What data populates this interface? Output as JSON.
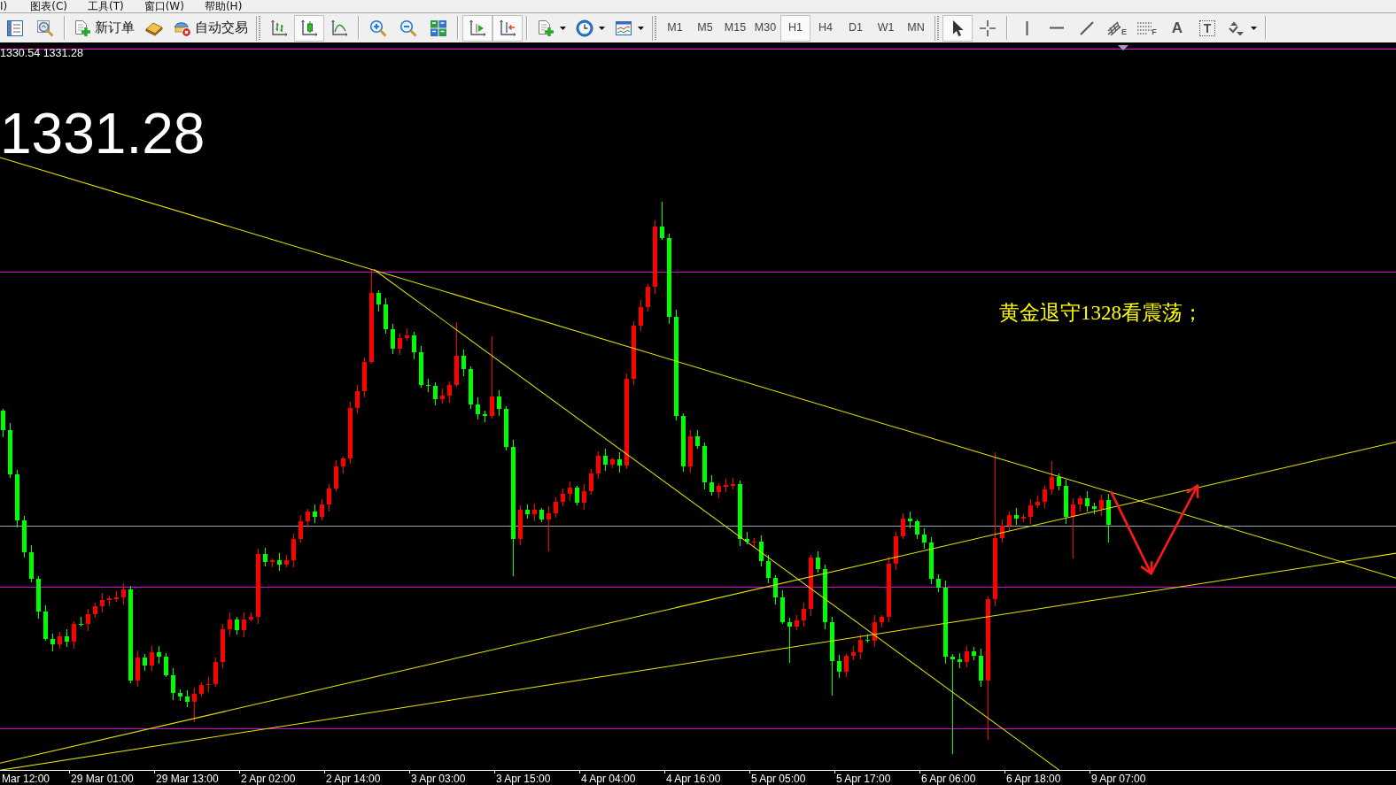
{
  "menu": [
    "I)",
    "图表(C)",
    "工具(T)",
    "窗口(W)",
    "帮助(H)"
  ],
  "toolbar": [
    {
      "kind": "market_watch",
      "pressed": false
    },
    {
      "kind": "strategy_tester",
      "pressed": false
    },
    {
      "kind": "separator"
    },
    {
      "kind": "new_order",
      "label": "新订单",
      "pressed": false
    },
    {
      "kind": "editor",
      "pressed": false
    },
    {
      "kind": "autotrading",
      "label": "自动交易",
      "pressed": false
    },
    {
      "kind": "grip"
    },
    {
      "kind": "bar_chart",
      "pressed": false
    },
    {
      "kind": "candlesticks",
      "pressed": true
    },
    {
      "kind": "line_chart",
      "pressed": false
    },
    {
      "kind": "separator"
    },
    {
      "kind": "zoom_in",
      "pressed": false
    },
    {
      "kind": "zoom_out",
      "pressed": false
    },
    {
      "kind": "tile_windows",
      "pressed": false
    },
    {
      "kind": "separator"
    },
    {
      "kind": "chart_shift",
      "pressed": true
    },
    {
      "kind": "auto_scroll",
      "pressed": true
    },
    {
      "kind": "separator"
    },
    {
      "kind": "indicators",
      "pressed": false,
      "dropdown": true
    },
    {
      "kind": "periods",
      "pressed": false,
      "dropdown": true
    },
    {
      "kind": "templates",
      "pressed": false,
      "dropdown": true
    },
    {
      "kind": "grip"
    },
    {
      "kind": "timeframe",
      "label": "M1",
      "selected": false
    },
    {
      "kind": "timeframe",
      "label": "M5",
      "selected": false
    },
    {
      "kind": "timeframe",
      "label": "M15",
      "selected": false
    },
    {
      "kind": "timeframe",
      "label": "M30",
      "selected": false
    },
    {
      "kind": "timeframe",
      "label": "H1",
      "selected": true
    },
    {
      "kind": "timeframe",
      "label": "H4",
      "selected": false
    },
    {
      "kind": "timeframe",
      "label": "D1",
      "selected": false
    },
    {
      "kind": "timeframe",
      "label": "W1",
      "selected": false
    },
    {
      "kind": "timeframe",
      "label": "MN",
      "selected": false
    },
    {
      "kind": "grip"
    },
    {
      "kind": "cursor",
      "pressed": true
    },
    {
      "kind": "crosshair",
      "pressed": false
    },
    {
      "kind": "separator"
    },
    {
      "kind": "vertical_line",
      "pressed": false
    },
    {
      "kind": "horizontal_line",
      "pressed": false
    },
    {
      "kind": "trend_line",
      "pressed": false
    },
    {
      "kind": "fibo_channel",
      "label": "E",
      "pressed": false
    },
    {
      "kind": "fibo_lines",
      "label": "F",
      "pressed": false
    },
    {
      "kind": "text",
      "label": "A",
      "pressed": false
    },
    {
      "kind": "text_label",
      "label": "T",
      "pressed": false
    },
    {
      "kind": "arrows",
      "pressed": false,
      "dropdown": true
    },
    {
      "kind": "separator"
    }
  ],
  "chart": {
    "quote": "1330.54 1331.28",
    "price": "1331.28",
    "note": "黄金退守1328看震荡；"
  },
  "time_axis": [
    "Mar 12:00",
    "29 Mar 01:00",
    "29 Mar 13:00",
    "2 Apr 02:00",
    "2 Apr 14:00",
    "3 Apr 03:00",
    "3 Apr 15:00",
    "4 Apr 04:00",
    "4 Apr 16:00",
    "5 Apr 05:00",
    "5 Apr 17:00",
    "6 Apr 06:00",
    "6 Apr 18:00",
    "9 Apr 07:00"
  ]
}
